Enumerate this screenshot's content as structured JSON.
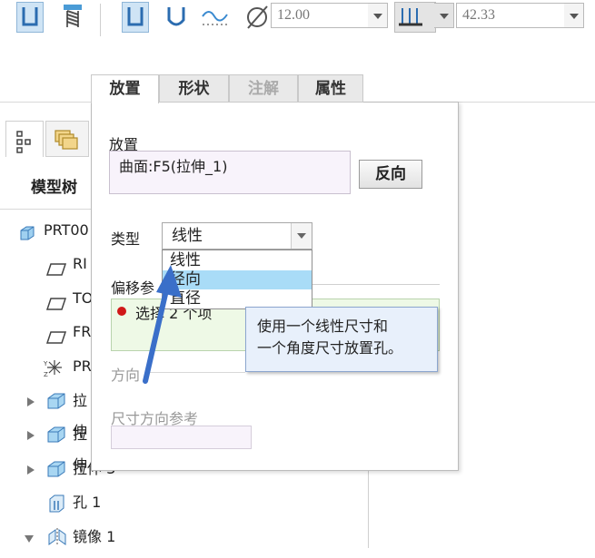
{
  "toolbar": {
    "diameter_value": "12.00",
    "depth_value": "42.33",
    "icons": [
      "simple-hole-icon",
      "standard-hole-icon",
      "straight-hole-icon",
      "sketch-hole-icon",
      "profile-icon",
      "diameter-icon",
      "depth-icon"
    ]
  },
  "tabs": [
    "放置",
    "形状",
    "注解",
    "属性"
  ],
  "placement": {
    "section_label": "放置",
    "surface_value": "曲面:F5(拉伸_1)",
    "flip_button": "反向",
    "type_label": "类型",
    "type_value": "线性",
    "type_options": [
      "线性",
      "径向",
      "直径"
    ],
    "selected_option": "径向",
    "offset_label": "偏移参",
    "offset_item": "选择 2 个项",
    "tooltip_line1": "使用一个线性尺寸和",
    "tooltip_line2": "一个角度尺寸放置孔。",
    "direction_label": "方向",
    "dim_ref_label": "尺寸方向参考"
  },
  "model_tree": {
    "tab_label": "模型树",
    "items": [
      {
        "label": "PRT00",
        "icon": "part-icon"
      },
      {
        "label": "RI",
        "icon": "datum-plane-icon"
      },
      {
        "label": "TO",
        "icon": "datum-plane-icon"
      },
      {
        "label": "FR",
        "icon": "datum-plane-icon"
      },
      {
        "label": "PR",
        "icon": "csys-icon"
      },
      {
        "label": "拉伸",
        "icon": "extrude-icon"
      },
      {
        "label": "拉伸",
        "icon": "extrude-icon"
      },
      {
        "label": "拉伸 3",
        "icon": "extrude-icon"
      },
      {
        "label": "孔 1",
        "icon": "hole-icon"
      },
      {
        "label": "镜像 1",
        "icon": "mirror-icon"
      }
    ]
  },
  "colors": {
    "accent_blue": "#3a6fc9",
    "selection": "#a9dcf7",
    "tooltip_bg": "#e8f0fb",
    "red_dot": "#d01818"
  }
}
